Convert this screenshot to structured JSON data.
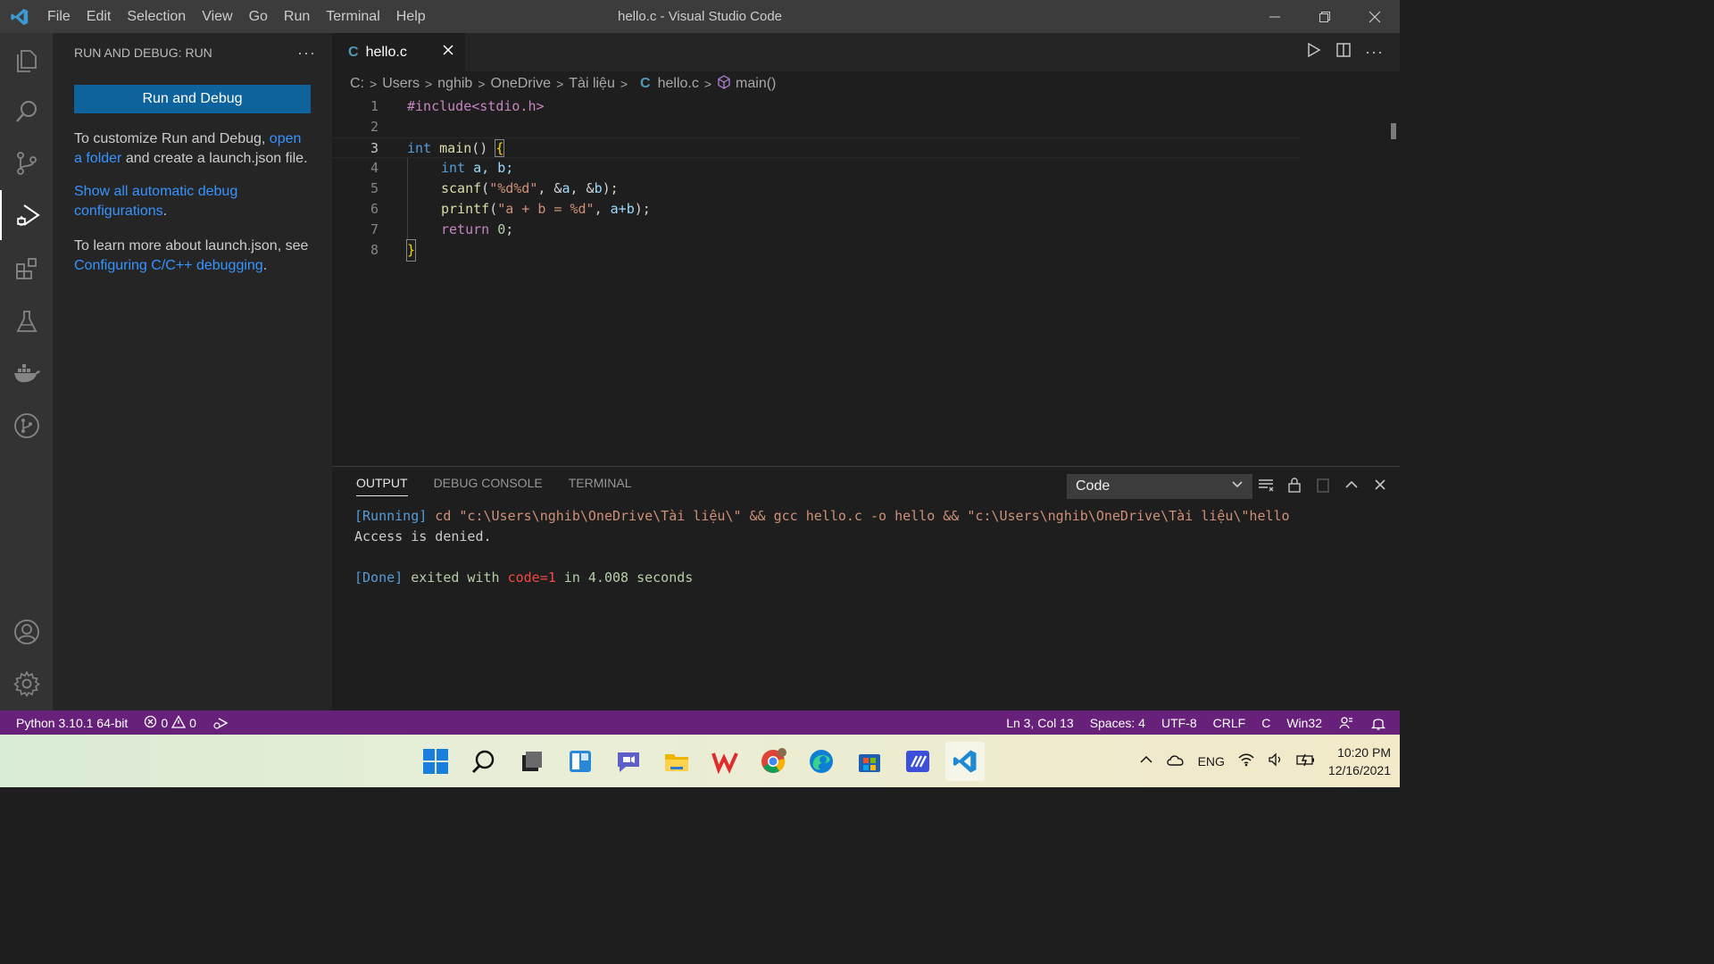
{
  "window": {
    "title": "hello.c - Visual Studio Code",
    "menu": [
      "File",
      "Edit",
      "Selection",
      "View",
      "Go",
      "Run",
      "Terminal",
      "Help"
    ]
  },
  "activity_bar": [
    "explorer-icon",
    "search-icon",
    "source-control-icon",
    "run-debug-icon",
    "extensions-icon",
    "testing-icon",
    "docker-icon",
    "git-graph-icon",
    "accounts-icon",
    "settings-gear-icon"
  ],
  "sidebar": {
    "title": "RUN AND DEBUG: RUN",
    "more": "···",
    "run_button": "Run and Debug",
    "p1_pre": "To customize Run and Debug, ",
    "p1_link": "open a folder",
    "p1_post": " and create a launch.json file.",
    "p2_link": "Show all automatic debug configurations",
    "p2_post": ".",
    "p3_pre": "To learn more about launch.json, see ",
    "p3_link": "Configuring C/C++ debugging",
    "p3_post": "."
  },
  "editor": {
    "tab_icon": "C",
    "tab_name": "hello.c",
    "breadcrumb": [
      "C:",
      "Users",
      "nghib",
      "OneDrive",
      "Tài liệu",
      "hello.c",
      "main()"
    ],
    "line_numbers": [
      "1",
      "2",
      "3",
      "4",
      "5",
      "6",
      "7",
      "8"
    ],
    "current_line": 3
  },
  "code": {
    "l1": "#include<stdio.h>",
    "l3_kw": "int",
    "l3_fn": " main",
    "l3_par": "() ",
    "l3_br": "{",
    "l4_kw": "int",
    "l4_id": " a, b;",
    "l5_fn": "scanf",
    "l5_p1": "(",
    "l5_str": "\"%d%d\"",
    "l5_p2": ", &",
    "l5_a": "a",
    "l5_p3": ", &",
    "l5_b": "b",
    "l5_p4": ");",
    "l6_fn": "printf",
    "l6_p1": "(",
    "l6_str": "\"a + b = %d\"",
    "l6_p2": ", ",
    "l6_ab": "a+b",
    "l6_p3": ");",
    "l7_kw": "return",
    "l7_sp": " ",
    "l7_num": "0",
    "l7_semi": ";",
    "l8": "}"
  },
  "panel": {
    "tabs": [
      "OUTPUT",
      "DEBUG CONSOLE",
      "TERMINAL"
    ],
    "active_tab": "OUTPUT",
    "channel": "Code",
    "out_running": "[Running]",
    "out_cmd": " cd \"c:\\Users\\nghib\\OneDrive\\Tài liệu\\\" && gcc hello.c -o hello && \"c:\\Users\\nghib\\OneDrive\\Tài liệu\\\"hello",
    "out_denied": "Access is denied.",
    "out_done": "[Done]",
    "out_exited": " exited with ",
    "out_code": "code=1",
    "out_in": " in ",
    "out_secs": "4.008",
    "out_seconds": " seconds"
  },
  "status": {
    "python": "Python 3.10.1 64-bit",
    "errors": "0",
    "warnings": "0",
    "position": "Ln 3, Col 13",
    "spaces": "Spaces: 4",
    "encoding": "UTF-8",
    "eol": "CRLF",
    "language": "C",
    "platform": "Win32"
  },
  "taskbar": {
    "apps": [
      "windows-start-icon",
      "search-icon",
      "task-view-icon",
      "widgets-icon",
      "teams-chat-icon",
      "file-explorer-icon",
      "wps-office-icon",
      "chrome-icon",
      "edge-icon",
      "store-icon",
      "vscode-insiders-icon",
      "vscode-icon"
    ],
    "lang": "ENG",
    "time": "10:20 PM",
    "date": "12/16/2021"
  },
  "colors": {
    "statusbar": "#68217a",
    "accent_button": "#0e639c",
    "link": "#3794ff"
  }
}
